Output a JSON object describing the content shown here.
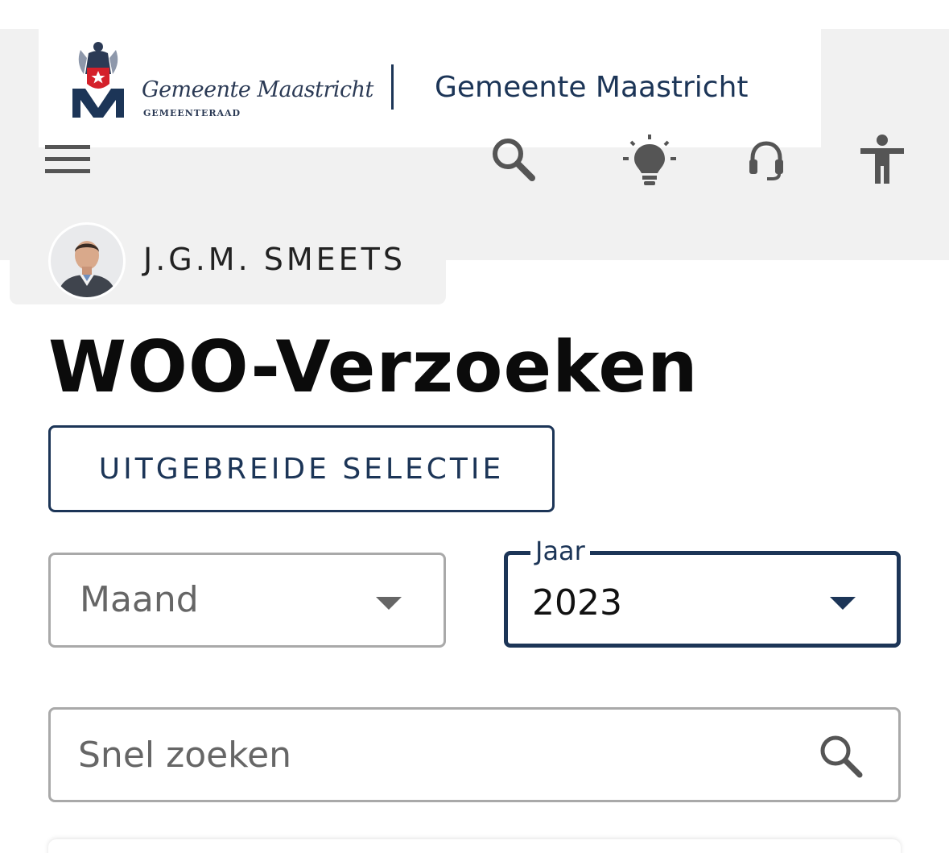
{
  "header": {
    "logo_title": "Gemeente Maastricht",
    "logo_subtitle": "GEMEENTERAAD",
    "site_name": "Gemeente Maastricht",
    "icons": [
      "menu-icon",
      "search-icon",
      "lightbulb-icon",
      "headset-icon",
      "accessibility-icon"
    ]
  },
  "profile": {
    "name": "J.G.M. SMEETS"
  },
  "main": {
    "title": "WOO-Verzoeken",
    "advanced_selection_label": "UITGEBREIDE SELECTIE",
    "month_select": {
      "value": "Maand"
    },
    "year_select": {
      "label": "Jaar",
      "value": "2023"
    },
    "search": {
      "placeholder": "Snel zoeken"
    }
  },
  "colors": {
    "brand_navy": "#1c3557",
    "logo_red": "#d4202a",
    "header_gray": "#f1f1f1"
  }
}
